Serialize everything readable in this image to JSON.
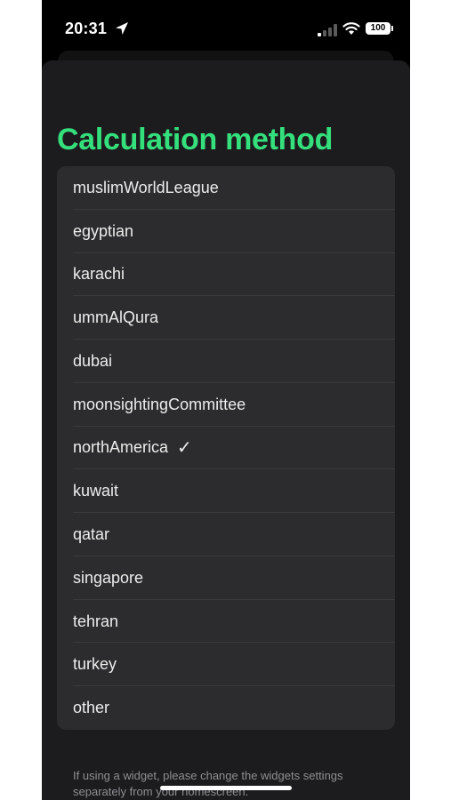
{
  "status_bar": {
    "time": "20:31",
    "battery": "100"
  },
  "page": {
    "title": "Calculation method"
  },
  "methods": [
    {
      "label": "muslimWorldLeague",
      "selected": false
    },
    {
      "label": "egyptian",
      "selected": false
    },
    {
      "label": "karachi",
      "selected": false
    },
    {
      "label": "ummAlQura",
      "selected": false
    },
    {
      "label": "dubai",
      "selected": false
    },
    {
      "label": "moonsightingCommittee",
      "selected": false
    },
    {
      "label": "northAmerica",
      "selected": true
    },
    {
      "label": "kuwait",
      "selected": false
    },
    {
      "label": "qatar",
      "selected": false
    },
    {
      "label": "singapore",
      "selected": false
    },
    {
      "label": "tehran",
      "selected": false
    },
    {
      "label": "turkey",
      "selected": false
    },
    {
      "label": "other",
      "selected": false
    }
  ],
  "check_glyph": "✓",
  "footer": {
    "note": "If using a widget, please change the widgets settings separately from your homescreen."
  },
  "colors": {
    "accent": "#34e07c",
    "sheet_background": "#1c1c1e",
    "list_background": "#2c2c2e"
  },
  "icons": {
    "location": "location-arrow-icon",
    "signal": "cellular-signal-icon",
    "wifi": "wifi-icon",
    "battery": "battery-icon"
  }
}
